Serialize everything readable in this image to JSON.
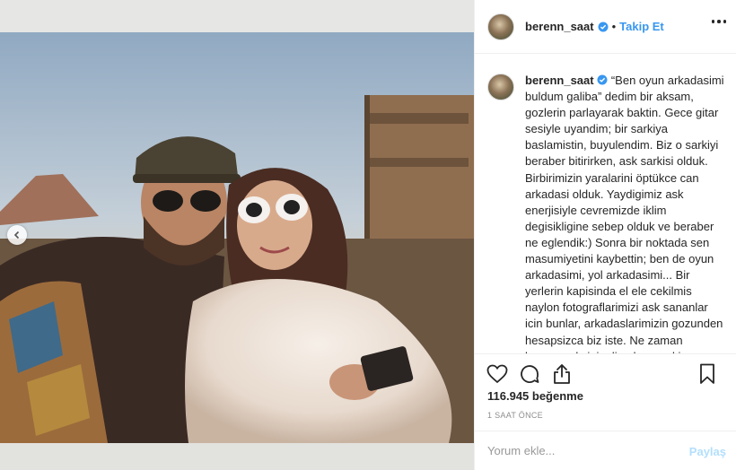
{
  "post": {
    "username": "berenn_saat",
    "follow_label": "Takip Et",
    "separator": "•",
    "caption_username": "berenn_saat",
    "caption_body": "“Ben oyun arkadasimi buldum galiba” dedim bir aksam, gozlerin parlayarak baktin. Gece gitar sesiyle uyandim; bir sarkiya baslamistin, buyulendim. Biz o sarkiyi beraber bitirirken, ask sarkisi olduk. Birbirimizin yaralarini öptükce can arkadasi olduk. Yaydigimiz ask enerjisiyle cevremizde iklim degisikligine sebep olduk ve beraber ne eglendik:) Sonra bir noktada sen masumiyetini kaybettin; ben de oyun arkadasimi, yol arkadasimi... Bir yerlerin kapisinda el ele cekilmis naylon fotograflarimizi ask sananlar icin bunlar, arkadaslarimizin gozunden hesapsizca biz iste. Ne zaman bosanacaksiniz diyorlar sureki; guvenmek, baglanmak, bagislamak, vazgecmek butun bu agir duygusal sureci hic merak eden yok. Bosanmak icin en kolay kismi, ben",
    "likes": "116.945 beğenme",
    "timestamp": "1 SAAT ÖNCE"
  },
  "comment": {
    "placeholder": "Yorum ekle...",
    "post_label": "Paylaş"
  },
  "icons": {
    "verified": "verified-badge-icon",
    "more": "more-options-icon",
    "like": "heart-icon",
    "comment": "comment-icon",
    "share": "share-icon",
    "save": "bookmark-icon",
    "prev": "chevron-left-icon"
  },
  "colors": {
    "accent": "#3897f0",
    "muted": "#8e8e8e",
    "post_disabled": "#b2dffc"
  }
}
